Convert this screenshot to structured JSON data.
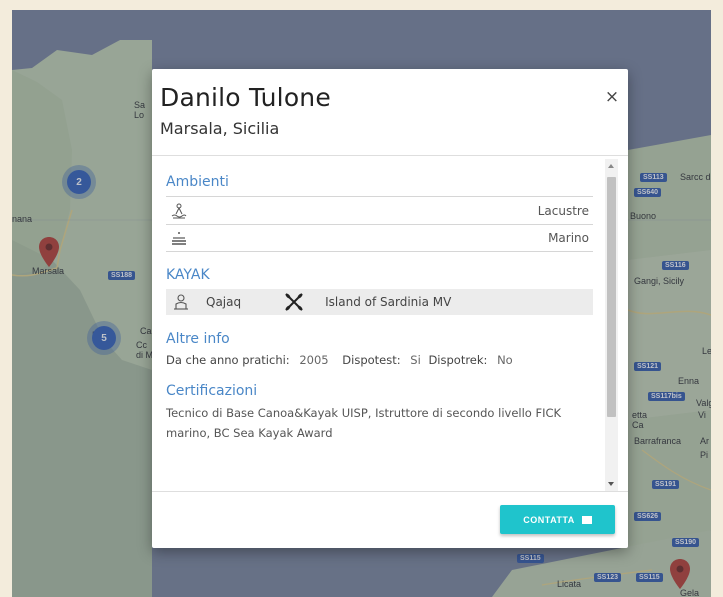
{
  "map": {
    "labels": [
      "Marsala",
      "Gangi, Sicily",
      "Enna",
      "Barrafranca",
      "Licata",
      "Gela",
      "Valg",
      "Sarcc di Car",
      "Buono",
      "Sa",
      "Lo",
      "nana",
      "M",
      "Ca",
      "di M",
      "Pi",
      "Ar",
      "Le",
      "Cc",
      "Vi",
      "etta",
      "Ca"
    ],
    "road_shields": [
      "SS188",
      "SS113",
      "SS116",
      "SS640",
      "SS121",
      "SS117bis",
      "SS191",
      "SS626",
      "SS190",
      "SS115",
      "SS123",
      "SS115"
    ],
    "clusters": [
      "2",
      "5"
    ]
  },
  "modal": {
    "name": "Danilo Tulone",
    "location": "Marsala, Sicilia",
    "close_label": "×",
    "ambienti": {
      "title": "Ambienti",
      "items": [
        {
          "icon": "lake-icon",
          "label": "Lacustre"
        },
        {
          "icon": "sea-icon",
          "label": "Marino"
        }
      ]
    },
    "kayak": {
      "title": "KAYAK",
      "model": "Qajaq",
      "hull": "Island of Sardinia MV"
    },
    "altre_info": {
      "title": "Altre info",
      "year_label": "Da che anno pratichi:",
      "year_value": "2005",
      "dispotest_label": "Dispotest:",
      "dispotest_value": "Si",
      "dispotrek_label": "Dispotrek:",
      "dispotrek_value": "No"
    },
    "certificazioni": {
      "title": "Certificazioni",
      "text": "Tecnico di Base Canoa&Kayak UISP, Istruttore di secondo livello FICK marino, BC Sea Kayak Award"
    },
    "contact_label": "CONTATTA"
  },
  "colors": {
    "accent_blue": "#4a87c7",
    "contact_button": "#1fc4cc",
    "cluster": "#2e5fb8",
    "pin": "#b83a2c"
  }
}
